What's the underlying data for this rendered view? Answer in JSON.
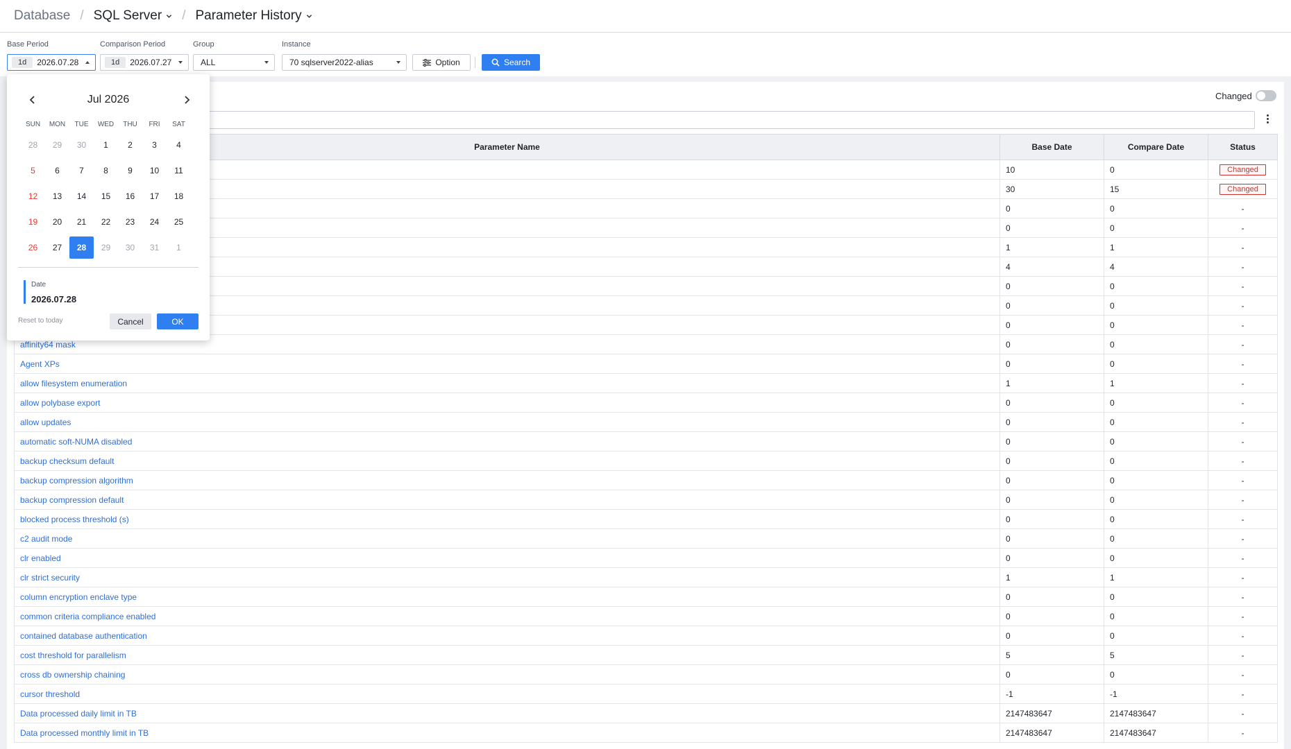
{
  "breadcrumb": {
    "root": "Database",
    "level2": "SQL Server",
    "level3": "Parameter History"
  },
  "filters": {
    "base_period": {
      "label": "Base Period",
      "range": "1d",
      "date": "2026.07.28"
    },
    "comparison_period": {
      "label": "Comparison Period",
      "range": "1d",
      "date": "2026.07.27"
    },
    "group": {
      "label": "Group",
      "value": "ALL"
    },
    "instance": {
      "label": "Instance",
      "value": "70 sqlserver2022-alias"
    },
    "option_label": "Option",
    "search_label": "Search"
  },
  "toolbar": {
    "changed_label": "Changed",
    "changed_toggle_on": false
  },
  "table": {
    "headers": [
      "Parameter Name",
      "Base Date",
      "Compare Date",
      "Status"
    ],
    "rows": [
      {
        "name": "",
        "base": "10",
        "compare": "0",
        "status": "Changed"
      },
      {
        "name": "",
        "base": "30",
        "compare": "15",
        "status": "Changed"
      },
      {
        "name": "",
        "base": "0",
        "compare": "0",
        "status": "-"
      },
      {
        "name": "",
        "base": "0",
        "compare": "0",
        "status": "-"
      },
      {
        "name": "",
        "base": "1",
        "compare": "1",
        "status": "-"
      },
      {
        "name": "",
        "base": "4",
        "compare": "4",
        "status": "-"
      },
      {
        "name": "",
        "base": "0",
        "compare": "0",
        "status": "-"
      },
      {
        "name": "",
        "base": "0",
        "compare": "0",
        "status": "-"
      },
      {
        "name": "",
        "base": "0",
        "compare": "0",
        "status": "-"
      },
      {
        "name": "affinity64 mask",
        "base": "0",
        "compare": "0",
        "status": "-"
      },
      {
        "name": "Agent XPs",
        "base": "0",
        "compare": "0",
        "status": "-"
      },
      {
        "name": "allow filesystem enumeration",
        "base": "1",
        "compare": "1",
        "status": "-"
      },
      {
        "name": "allow polybase export",
        "base": "0",
        "compare": "0",
        "status": "-"
      },
      {
        "name": "allow updates",
        "base": "0",
        "compare": "0",
        "status": "-"
      },
      {
        "name": "automatic soft-NUMA disabled",
        "base": "0",
        "compare": "0",
        "status": "-"
      },
      {
        "name": "backup checksum default",
        "base": "0",
        "compare": "0",
        "status": "-"
      },
      {
        "name": "backup compression algorithm",
        "base": "0",
        "compare": "0",
        "status": "-"
      },
      {
        "name": "backup compression default",
        "base": "0",
        "compare": "0",
        "status": "-"
      },
      {
        "name": "blocked process threshold (s)",
        "base": "0",
        "compare": "0",
        "status": "-"
      },
      {
        "name": "c2 audit mode",
        "base": "0",
        "compare": "0",
        "status": "-"
      },
      {
        "name": "clr enabled",
        "base": "0",
        "compare": "0",
        "status": "-"
      },
      {
        "name": "clr strict security",
        "base": "1",
        "compare": "1",
        "status": "-"
      },
      {
        "name": "column encryption enclave type",
        "base": "0",
        "compare": "0",
        "status": "-"
      },
      {
        "name": "common criteria compliance enabled",
        "base": "0",
        "compare": "0",
        "status": "-"
      },
      {
        "name": "contained database authentication",
        "base": "0",
        "compare": "0",
        "status": "-"
      },
      {
        "name": "cost threshold for parallelism",
        "base": "5",
        "compare": "5",
        "status": "-"
      },
      {
        "name": "cross db ownership chaining",
        "base": "0",
        "compare": "0",
        "status": "-"
      },
      {
        "name": "cursor threshold",
        "base": "-1",
        "compare": "-1",
        "status": "-"
      },
      {
        "name": "Data processed daily limit in TB",
        "base": "2147483647",
        "compare": "2147483647",
        "status": "-"
      },
      {
        "name": "Data processed monthly limit in TB",
        "base": "2147483647",
        "compare": "2147483647",
        "status": "-"
      }
    ]
  },
  "calendar": {
    "month_label": "Jul 2026",
    "weekdays": [
      "SUN",
      "MON",
      "TUE",
      "WED",
      "THU",
      "FRI",
      "SAT"
    ],
    "weeks": [
      [
        {
          "d": "28",
          "m": true
        },
        {
          "d": "29",
          "m": true
        },
        {
          "d": "30",
          "m": true
        },
        {
          "d": "1"
        },
        {
          "d": "2"
        },
        {
          "d": "3"
        },
        {
          "d": "4"
        }
      ],
      [
        {
          "d": "5"
        },
        {
          "d": "6"
        },
        {
          "d": "7"
        },
        {
          "d": "8"
        },
        {
          "d": "9"
        },
        {
          "d": "10"
        },
        {
          "d": "11"
        }
      ],
      [
        {
          "d": "12"
        },
        {
          "d": "13"
        },
        {
          "d": "14"
        },
        {
          "d": "15"
        },
        {
          "d": "16"
        },
        {
          "d": "17"
        },
        {
          "d": "18"
        }
      ],
      [
        {
          "d": "19"
        },
        {
          "d": "20"
        },
        {
          "d": "21"
        },
        {
          "d": "22"
        },
        {
          "d": "23"
        },
        {
          "d": "24"
        },
        {
          "d": "25"
        }
      ],
      [
        {
          "d": "26"
        },
        {
          "d": "27"
        },
        {
          "d": "28",
          "sel": true
        },
        {
          "d": "29",
          "m": true
        },
        {
          "d": "30",
          "m": true
        },
        {
          "d": "31",
          "m": true
        },
        {
          "d": "1",
          "m": true
        }
      ]
    ],
    "date_label": "Date",
    "date_value": "2026.07.28",
    "reset_label": "Reset to today",
    "cancel_label": "Cancel",
    "ok_label": "OK"
  },
  "colors": {
    "accent": "#2f7ff0",
    "link": "#2f6fd6",
    "changed": "#d32f2f",
    "sunday": "#e53935"
  },
  "icons": [
    "chevron-down-icon",
    "caret-up-icon",
    "caret-down-icon",
    "sliders-icon",
    "search-icon",
    "kebab-menu-icon",
    "chevron-left-icon",
    "chevron-right-icon"
  ]
}
